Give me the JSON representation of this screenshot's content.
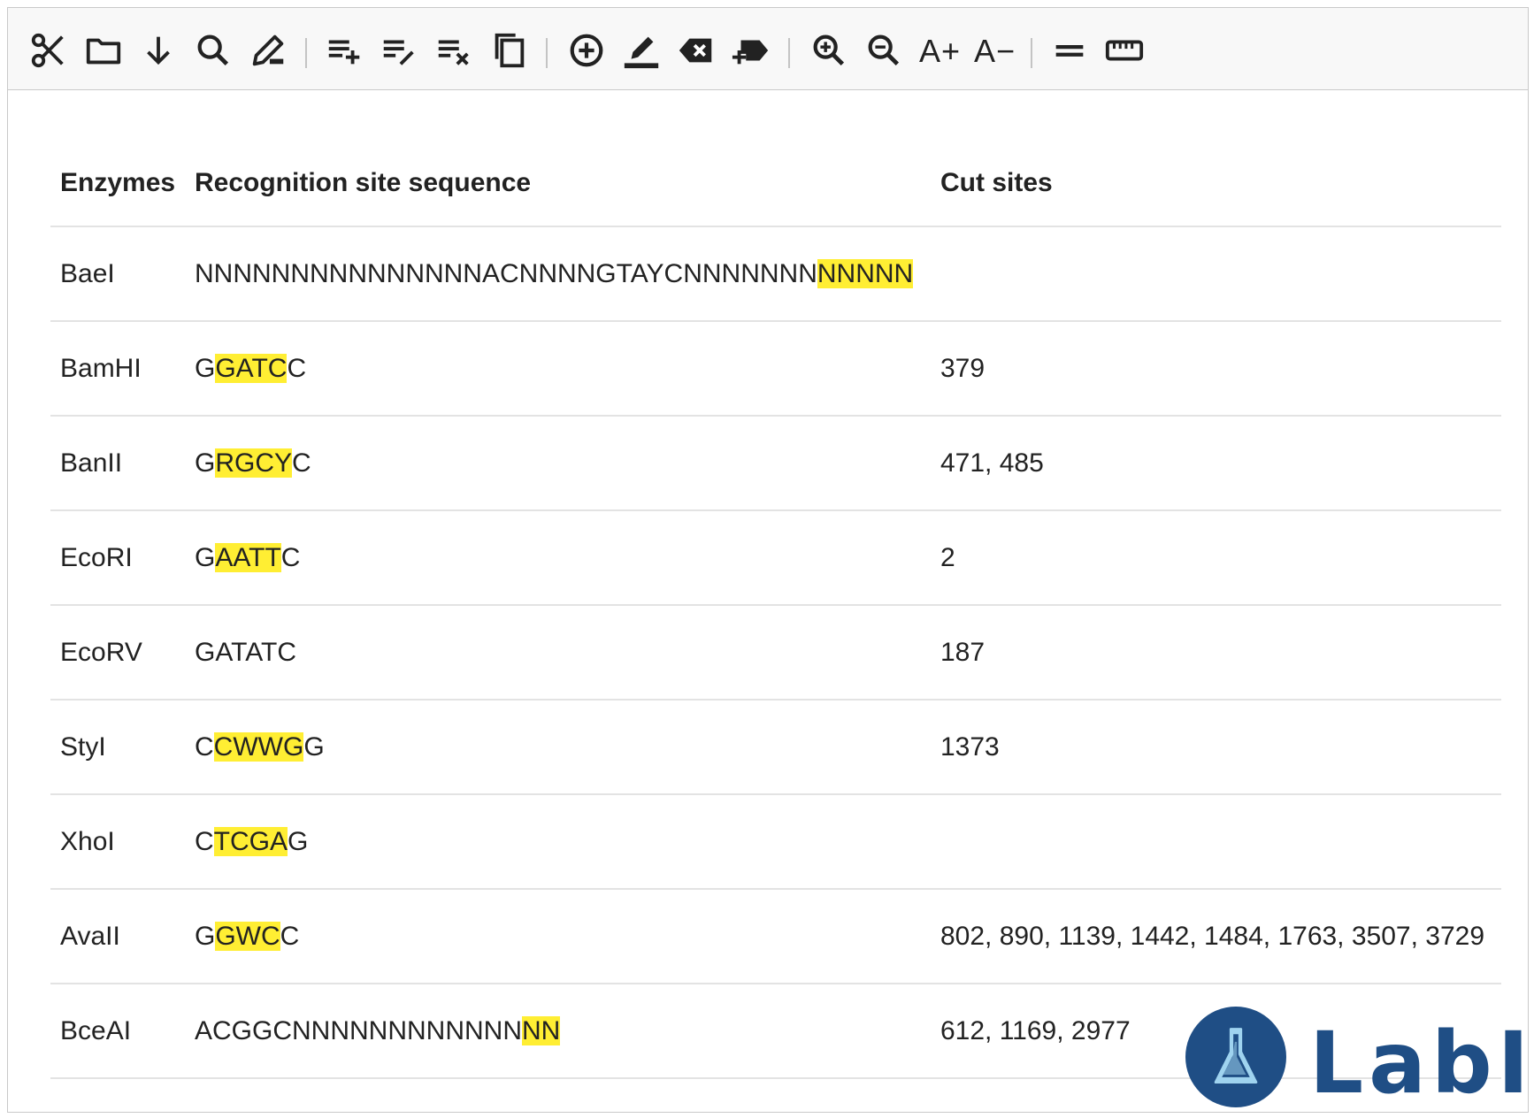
{
  "toolbar": {
    "buttons": [
      {
        "name": "scissors-icon",
        "label": "Cut"
      },
      {
        "name": "folder-icon",
        "label": "Open"
      },
      {
        "name": "arrow-down-icon",
        "label": "Download"
      },
      {
        "name": "search-icon",
        "label": "Search"
      },
      {
        "name": "edit-icon",
        "label": "Edit"
      },
      {
        "name": "list-add-icon",
        "label": "Add row"
      },
      {
        "name": "list-edit-icon",
        "label": "Edit list"
      },
      {
        "name": "list-remove-icon",
        "label": "Remove list"
      },
      {
        "name": "copy-icon",
        "label": "Copy"
      },
      {
        "name": "add-circle-icon",
        "label": "Add"
      },
      {
        "name": "highlight-pen-icon",
        "label": "Highlight"
      },
      {
        "name": "backspace-icon",
        "label": "Delete"
      },
      {
        "name": "label-add-icon",
        "label": "Add label"
      },
      {
        "name": "zoom-in-icon",
        "label": "Zoom in"
      },
      {
        "name": "zoom-out-icon",
        "label": "Zoom out"
      }
    ],
    "font_increase": "A+",
    "font_decrease": "A−"
  },
  "table": {
    "headers": {
      "enzyme": "Enzymes",
      "sequence": "Recognition site sequence",
      "cut_sites": "Cut sites"
    },
    "rows": [
      {
        "enzyme": "BaeI",
        "seq_pre": "NNNNNNNNNNNNNNNACNNNNGTAYCNNNNNNN",
        "seq_hl": "NNNNN",
        "seq_post": "",
        "cut_sites": ""
      },
      {
        "enzyme": "BamHI",
        "seq_pre": "G",
        "seq_hl": "GATC",
        "seq_post": "C",
        "cut_sites": "379"
      },
      {
        "enzyme": "BanII",
        "seq_pre": "G",
        "seq_hl": "RGCY",
        "seq_post": "C",
        "cut_sites": "471, 485"
      },
      {
        "enzyme": "EcoRI",
        "seq_pre": "G",
        "seq_hl": "AATT",
        "seq_post": "C",
        "cut_sites": "2"
      },
      {
        "enzyme": "EcoRV",
        "seq_pre": "GATATC",
        "seq_hl": "",
        "seq_post": "",
        "cut_sites": "187"
      },
      {
        "enzyme": "StyI",
        "seq_pre": "C",
        "seq_hl": "CWWG",
        "seq_post": "G",
        "cut_sites": "1373"
      },
      {
        "enzyme": "XhoI",
        "seq_pre": "C",
        "seq_hl": "TCGA",
        "seq_post": "G",
        "cut_sites": ""
      },
      {
        "enzyme": "AvaII",
        "seq_pre": "G",
        "seq_hl": "GWC",
        "seq_post": "C",
        "cut_sites": "802, 890, 1139, 1442, 1484, 1763, 3507, 3729"
      },
      {
        "enzyme": "BceAI",
        "seq_pre": "ACGGCNNNNNNNNNNNN",
        "seq_hl": "NN",
        "seq_post": "",
        "cut_sites": "612, 1169, 2977"
      }
    ]
  },
  "logo": {
    "text": "LabII"
  },
  "colors": {
    "highlight": "#ffee33",
    "brand": "#1f4e85"
  }
}
